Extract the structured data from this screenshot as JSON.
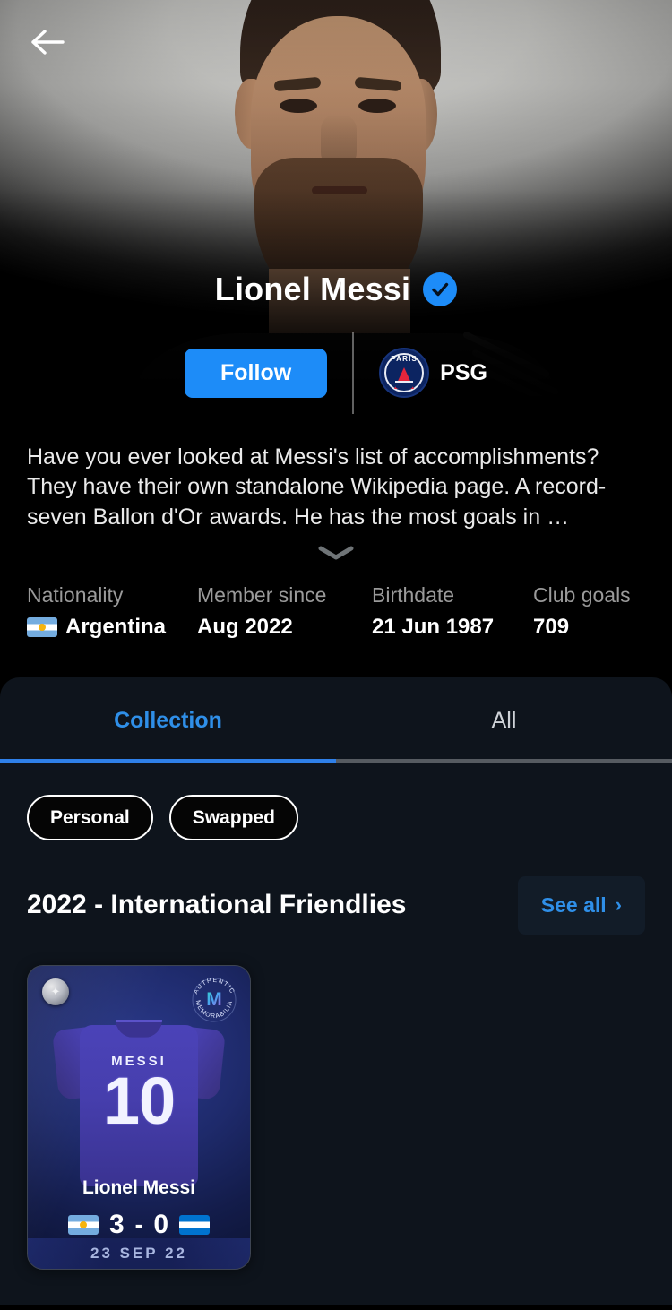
{
  "header": {
    "back_icon": "arrow-left-icon"
  },
  "profile": {
    "name": "Lionel Messi",
    "verified_icon": "verified-check-icon",
    "follow_label": "Follow",
    "club_name": "PSG",
    "club_badge_text": "PARIS",
    "club_badge_icon": "psg-crest-icon",
    "bio": "Have you ever looked at Messi's list of accomplishments? They have their own standalone Wikipedia page. A record-seven Ballon d'Or awards. He has the most goals in …",
    "expand_icon": "chevron-down-icon"
  },
  "stats": [
    {
      "label": "Nationality",
      "value": "Argentina",
      "flag": "argentina-flag-icon"
    },
    {
      "label": "Member since",
      "value": "Aug 2022"
    },
    {
      "label": "Birthdate",
      "value": "21 Jun 1987"
    },
    {
      "label": "Club goals",
      "value": "709"
    }
  ],
  "tabs": [
    {
      "label": "Collection",
      "active": true
    },
    {
      "label": "All",
      "active": false
    }
  ],
  "chips": [
    {
      "label": "Personal"
    },
    {
      "label": "Swapped"
    }
  ],
  "section": {
    "title": "2022 - International Friendlies",
    "see_all_label": "See all",
    "see_all_chevron": "›"
  },
  "cards": [
    {
      "rarity_icon": "star-badge-icon",
      "rarity_star": "✦",
      "authenticity_seal": "authentic-memorabilia-seal",
      "authenticity_mark": "M",
      "jersey_name": "MESSI",
      "jersey_number": "10",
      "player_name": "Lionel Messi",
      "home_flag": "argentina-flag-icon",
      "home_score": "3",
      "score_separator": "-",
      "away_score": "0",
      "away_flag": "honduras-flag-icon",
      "date": "23 SEP 22"
    }
  ],
  "colors": {
    "accent_blue": "#1d8cf8",
    "tab_active": "#2f8fe8",
    "panel_bg": "#0e141c",
    "page_bg": "#000000"
  }
}
